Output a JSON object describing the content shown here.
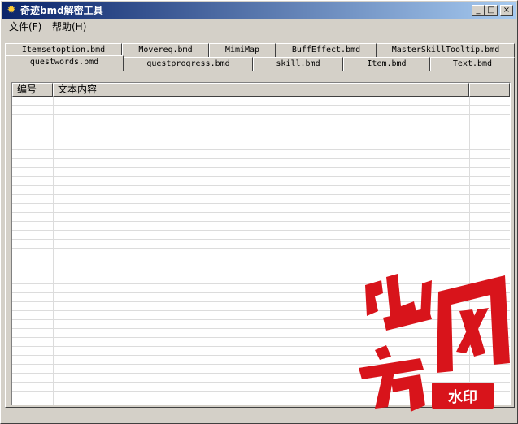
{
  "window": {
    "title": "奇迹bmd解密工具"
  },
  "titlebar_buttons": {
    "minimize": "_",
    "maximize": "□",
    "close": "×"
  },
  "menu": [
    {
      "label": "文件(F)"
    },
    {
      "label": "帮助(H)"
    }
  ],
  "tabs_row1": [
    "Itemsetoption.bmd",
    "Movereq.bmd",
    "MimiMap",
    "BuffEffect.bmd",
    "MasterSkillTooltip.bmd"
  ],
  "tabs_row2": [
    "questwords.bmd",
    "questprogress.bmd",
    "skill.bmd",
    "Item.bmd",
    "Text.bmd"
  ],
  "active_tab": "questwords.bmd",
  "list": {
    "columns": [
      "编号",
      "文本内容"
    ],
    "rows": []
  },
  "colors": {
    "titlebar_start": "#0a246a",
    "titlebar_end": "#a6caf0",
    "face": "#d4d0c8",
    "watermark_red": "#d8141b"
  },
  "watermark": {
    "chars": [
      "地",
      "方",
      "网"
    ],
    "badge": "水印"
  }
}
